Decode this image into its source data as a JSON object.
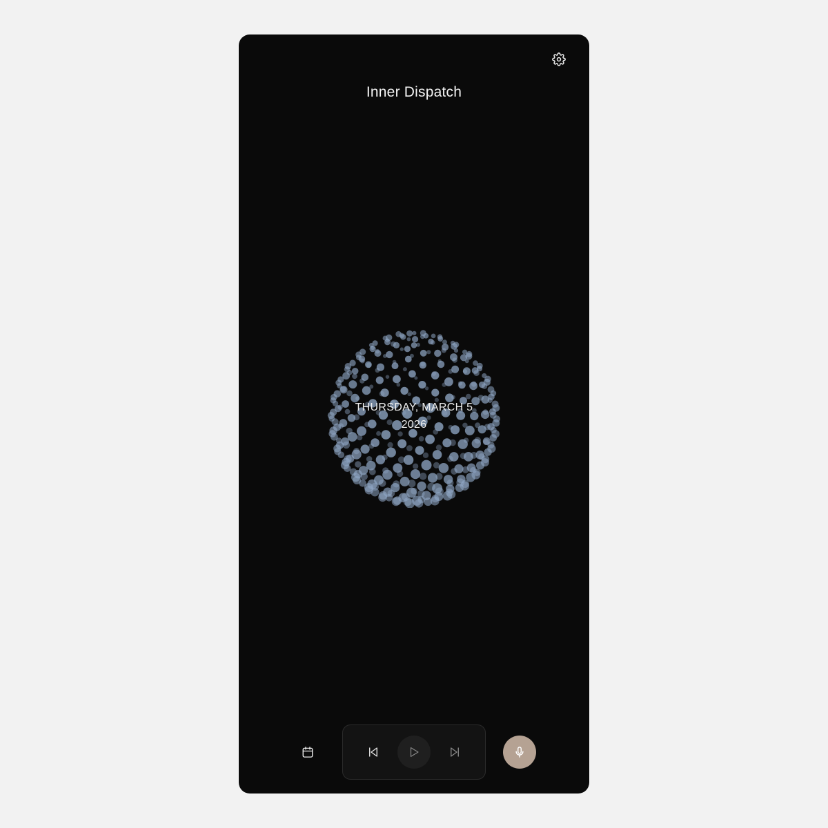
{
  "app": {
    "title": "Inner Dispatch"
  },
  "header": {
    "settings_icon": "gear-icon"
  },
  "orb": {
    "date_line1": "THURSDAY, MARCH 5",
    "date_line2": "2026",
    "particle_color": "#8fa6c4"
  },
  "controls": {
    "calendar_icon": "calendar-icon",
    "prev_icon": "skip-back-icon",
    "play_icon": "play-icon",
    "next_icon": "skip-forward-icon",
    "mic_icon": "microphone-icon",
    "mic_color": "#b5a293"
  },
  "colors": {
    "background": "#0a0a0a",
    "page": "#f2f2f2"
  }
}
